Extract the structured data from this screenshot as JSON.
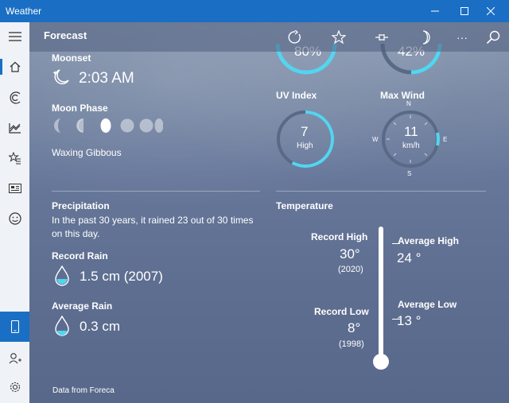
{
  "window": {
    "title": "Weather"
  },
  "toolbar": {
    "title": "Forecast",
    "more_label": "···"
  },
  "moon": {
    "moonset_label": "Moonset",
    "moonset_time": "2:03 AM",
    "phase_label": "Moon Phase",
    "phase_name": "Waxing Gibbous"
  },
  "uv": {
    "label": "UV Index",
    "value": "7",
    "level": "High",
    "fraction": 0.58
  },
  "wind": {
    "label": "Max Wind",
    "value": "11",
    "unit": "km/h",
    "n": "N",
    "e": "E",
    "s": "S",
    "w": "W"
  },
  "top_gauges": {
    "left_value": "80%",
    "right_value": "42%"
  },
  "precip": {
    "heading": "Precipitation",
    "description_line1": "In the past 30 years, it rained 23 out of 30 times",
    "description_line2": "on this day.",
    "record_label": "Record Rain",
    "record_value": "1.5 cm (2007)",
    "average_label": "Average Rain",
    "average_value": "0.3 cm"
  },
  "temperature": {
    "heading": "Temperature",
    "record_high_label": "Record High",
    "record_high_value": "30°",
    "record_high_year": "(2020)",
    "average_high_label": "Average High",
    "average_high_value": "24 °",
    "record_low_label": "Record Low",
    "record_low_value": "8°",
    "record_low_year": "(1998)",
    "average_low_label": "Average Low",
    "average_low_value": "13 °"
  },
  "footer": {
    "attribution": "Data from Foreca"
  },
  "colors": {
    "accent": "#1a6fc4",
    "gauge": "#53d5f0",
    "track": "#586a85"
  }
}
